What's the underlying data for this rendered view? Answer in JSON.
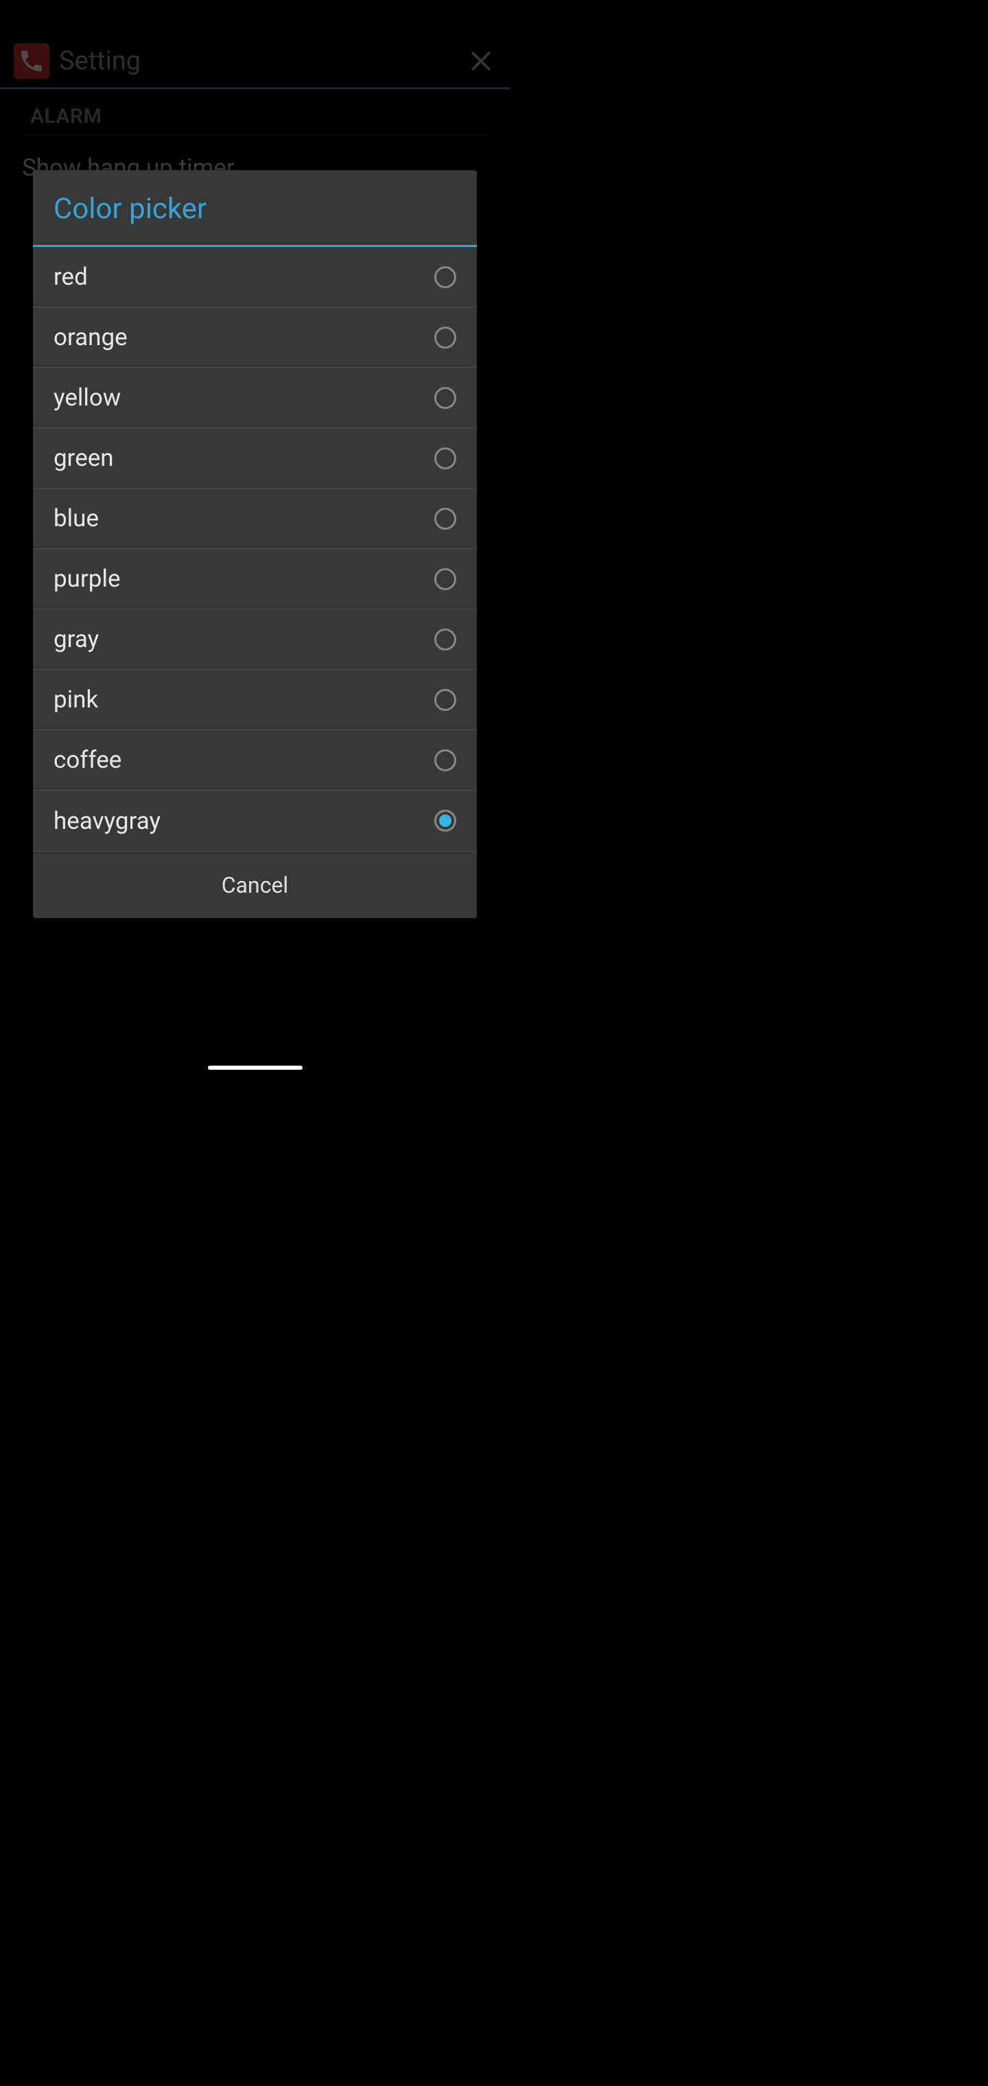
{
  "header": {
    "title": "Setting"
  },
  "settings": {
    "section_label": "ALARM",
    "row1_title": "Show hang up timer"
  },
  "dialog": {
    "title": "Color picker",
    "options": [
      {
        "label": "red",
        "selected": false
      },
      {
        "label": "orange",
        "selected": false
      },
      {
        "label": "yellow",
        "selected": false
      },
      {
        "label": "green",
        "selected": false
      },
      {
        "label": "blue",
        "selected": false
      },
      {
        "label": "purple",
        "selected": false
      },
      {
        "label": "gray",
        "selected": false
      },
      {
        "label": "pink",
        "selected": false
      },
      {
        "label": "coffee",
        "selected": false
      },
      {
        "label": "heavygray",
        "selected": true
      }
    ],
    "cancel_label": "Cancel"
  }
}
